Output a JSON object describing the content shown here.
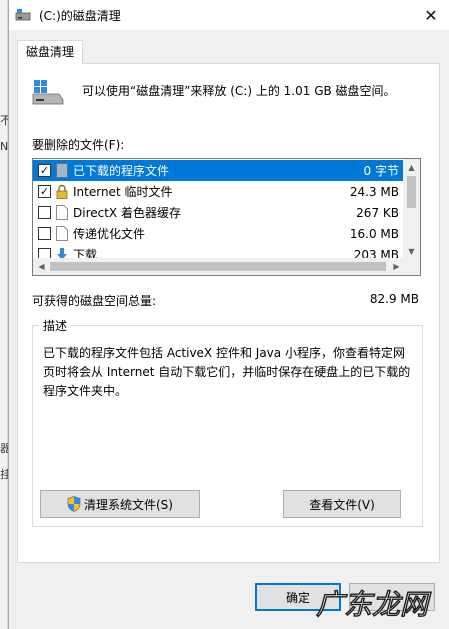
{
  "window": {
    "title": "(C:)的磁盘清理",
    "close_glyph": "✕"
  },
  "tab": {
    "label": "磁盘清理"
  },
  "header": {
    "text": "可以使用“磁盘清理”来释放  (C:) 上的 1.01 GB 磁盘空间。"
  },
  "files": {
    "label": "要删除的文件(F):",
    "items": [
      {
        "name": "已下载的程序文件",
        "size": "0 字节",
        "checked": true,
        "selected": true,
        "icon": "folder-icon"
      },
      {
        "name": "Internet 临时文件",
        "size": "24.3 MB",
        "checked": true,
        "selected": false,
        "icon": "lock-icon"
      },
      {
        "name": "DirectX 着色器缓存",
        "size": "267 KB",
        "checked": false,
        "selected": false,
        "icon": "document-icon"
      },
      {
        "name": "传递优化文件",
        "size": "16.0 MB",
        "checked": false,
        "selected": false,
        "icon": "document-icon"
      },
      {
        "name": "下载",
        "size": "203 MB",
        "checked": false,
        "selected": false,
        "icon": "download-arrow-icon"
      }
    ],
    "checkmark": "✓"
  },
  "total": {
    "label": "可获得的磁盘空间总量:",
    "value": "82.9 MB"
  },
  "description": {
    "title": "描述",
    "text": "已下载的程序文件包括 ActiveX 控件和 Java 小程序，你查看特定网页时将会从 Internet 自动下载它们，并临时保存在硬盘上的已下载的程序文件夹中。"
  },
  "buttons": {
    "clean_system": "清理系统文件(S)",
    "view_files": "查看文件(V)",
    "ok": "确定"
  },
  "watermark": {
    "text": "广东龙网"
  },
  "background_chars": [
    "不",
    "N",
    "器",
    "挂"
  ],
  "colors": {
    "selection": "#0078d7",
    "accent": "#0078d7"
  }
}
